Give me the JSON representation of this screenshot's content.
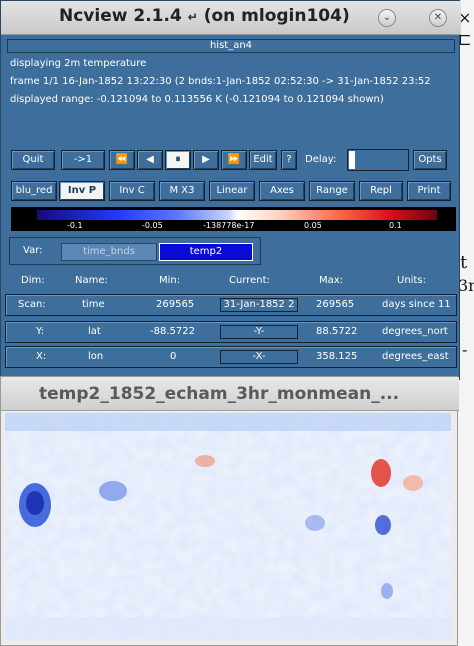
{
  "main_window": {
    "title": "Ncview 2.1.4",
    "return_glyph": "↵",
    "host": "(on mlogin104)",
    "collapse_glyph": "⌄",
    "close_glyph": "✕",
    "file_name": "hist_an4",
    "info": {
      "line1": "displaying 2m temperature",
      "line2": "frame 1/1 16-Jan-1852 13:22:30 (2 bnds:1-Jan-1852 02:52:30 -> 31-Jan-1852 23:52",
      "line3": "displayed range: -0.121094 to 0.113556 K (-0.121094 to 0.121094 shown)"
    }
  },
  "toolbar": {
    "quit": "Quit",
    "back_step": "->1",
    "rewind": "⏪",
    "step_back": "◀",
    "pause": "⏸",
    "step_forward": "▶",
    "fast_forward": "⏩",
    "edit": "Edit",
    "help": "?",
    "delay_label": "Delay:",
    "opts": "Opts"
  },
  "display_buttons": {
    "colormap": "blu_red",
    "inv_p": "Inv P",
    "inv_c": "Inv C",
    "magnify": "M X3",
    "scale": "Linear",
    "axes": "Axes",
    "range": "Range",
    "repl": "Repl",
    "print": "Print"
  },
  "colorbar": {
    "ticks": [
      "-0.1",
      "-0.05",
      "-138778e-17",
      "0.05",
      "0.1"
    ],
    "colors": [
      "#1a0a7a",
      "#1d3bff",
      "#ffffff",
      "#ff6a4a",
      "#6a0510"
    ]
  },
  "variables": {
    "label": "Var:",
    "items": [
      "time_bnds",
      "temp2"
    ],
    "selected": "temp2"
  },
  "dims": {
    "headers": [
      "Dim:",
      "Name:",
      "Min:",
      "Current:",
      "Max:",
      "Units:"
    ],
    "rows": [
      {
        "dim": "Scan:",
        "name": "time",
        "min": "269565",
        "current": "31-Jan-1852 2",
        "max": "269565",
        "units": "days since 11"
      },
      {
        "dim": "Y:",
        "name": "lat",
        "min": "-88.5722",
        "current": "-Y-",
        "max": "88.5722",
        "units": "degrees_nort"
      },
      {
        "dim": "X:",
        "name": "lon",
        "min": "0",
        "current": "-X-",
        "max": "358.125",
        "units": "degrees_east"
      }
    ]
  },
  "plot_window": {
    "title": "temp2_1852_echam_3hr_monmean_..."
  },
  "background": {
    "glyph_1": "×",
    "glyph_2": "⊏",
    "glyph_3": "t",
    "glyph_4": "3n",
    "glyph_5": "-"
  }
}
